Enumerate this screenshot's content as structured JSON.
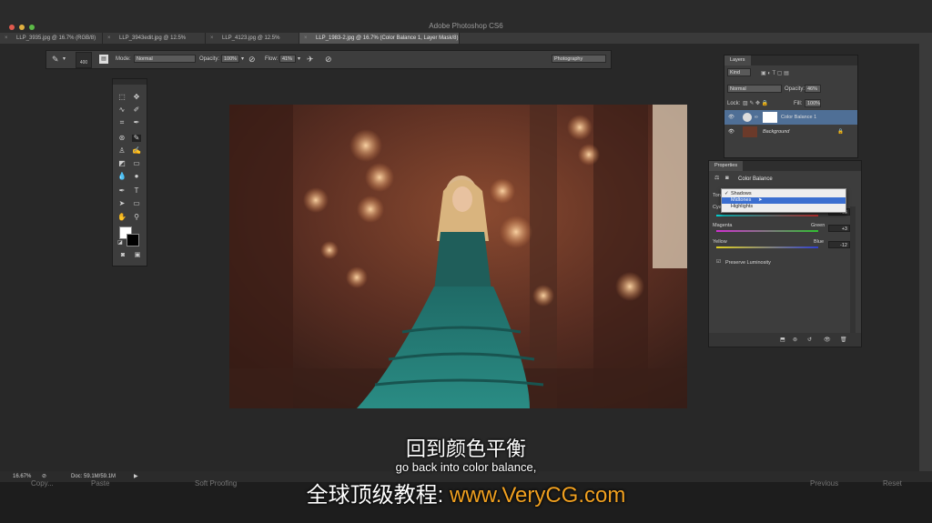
{
  "window": {
    "title": "Adobe Photoshop CS6"
  },
  "tabs": [
    {
      "label": "LLP_3935.jpg @ 16.7% (RGB/8)"
    },
    {
      "label": "LLP_3943edit.jpg @ 12.5% (RGB/8)"
    },
    {
      "label": "LLP_4123.jpg @ 12.5% (RGB/8)"
    },
    {
      "label": "LLP_1983-2.jpg @ 16.7% (Color Balance 1, Layer Mask/8) *"
    }
  ],
  "options_bar": {
    "brush_size": "400",
    "mode_label": "Mode:",
    "mode_value": "Normal",
    "opacity_label": "Opacity:",
    "opacity_value": "100%",
    "flow_label": "Flow:",
    "flow_value": "41%",
    "workspace": "Photography"
  },
  "layers_panel": {
    "tab": "Layers",
    "kind": "Kind",
    "blend_mode": "Normal",
    "opacity_label": "Opacity:",
    "opacity_value": "46%",
    "lock_label": "Lock:",
    "fill_label": "Fill:",
    "fill_value": "100%",
    "layers": [
      {
        "name": "Color Balance 1"
      },
      {
        "name": "Background"
      }
    ]
  },
  "properties_panel": {
    "tab": "Properties",
    "adjustment": "Color Balance",
    "tone_label": "Tone",
    "tone_options": [
      "Shadows",
      "Midtones",
      "Highlights"
    ],
    "sliders": [
      {
        "left": "Cyan",
        "right": "Red",
        "value": "+13",
        "position": 0.5
      },
      {
        "left": "Magenta",
        "right": "Green",
        "value": "+3",
        "position": 0.54
      },
      {
        "left": "Yellow",
        "right": "Blue",
        "value": "-12",
        "position": 0.44
      }
    ],
    "preserve_luminosity": "Preserve Luminosity"
  },
  "status_bar": {
    "zoom": "16.67%",
    "doc": "Doc: 59.1M/59.1M"
  },
  "bottom_bar": {
    "copy": "Copy...",
    "paste": "Paste",
    "soft_proofing": "Soft Proofing",
    "previous": "Previous",
    "reset": "Reset"
  },
  "subtitles": {
    "chinese": "回到颜色平衡",
    "english": "go back into color balance,",
    "watermark_prefix": "全球顶级教程:",
    "watermark_url": "www.VeryCG.com"
  },
  "colors": {
    "accent": "#3b6fd0",
    "watermark_url": "#f0a020"
  }
}
